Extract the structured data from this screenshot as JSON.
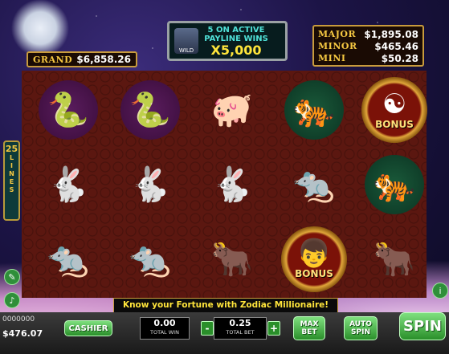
{
  "jackpots": {
    "grand_label": "GRAND",
    "grand_value": "$6,858.26",
    "major_label": "MAJOR",
    "major_value": "$1,895.08",
    "minor_label": "MINOR",
    "minor_value": "$465.46",
    "mini_label": "MINI",
    "mini_value": "$50.28"
  },
  "banner": {
    "line1": "5 ON ACTIVE",
    "line2": "PAYLINE WINS",
    "multiplier": "X5,000",
    "wild_label": "WILD"
  },
  "lines": {
    "count": "25",
    "word": "LINES"
  },
  "reels": [
    [
      "snake",
      "snake",
      "pig",
      "tiger",
      "bonus-yinyang"
    ],
    [
      "rabbit",
      "rabbit",
      "rabbit",
      "rat",
      "tiger"
    ],
    [
      "rat",
      "rat",
      "ox",
      "bonus-boy",
      "ox"
    ]
  ],
  "bonus_text": "BONUS",
  "message": "Know your Fortune with Zodiac Millionaire!",
  "bottom": {
    "balance_id": "0000000",
    "balance": "$476.07",
    "cashier": "CASHIER",
    "total_win_value": "0.00",
    "total_win_caption": "TOTAL WIN",
    "total_bet_value": "0.25",
    "total_bet_caption": "TOTAL BET",
    "minus": "-",
    "plus": "+",
    "max_bet": "MAX BET",
    "auto_spin": "AUTO SPIN",
    "spin": "SPIN"
  },
  "colors": {
    "accent_gold": "#c89b3c",
    "spin_green": "#2a8f2a",
    "reel_bg": "#5b1710"
  }
}
